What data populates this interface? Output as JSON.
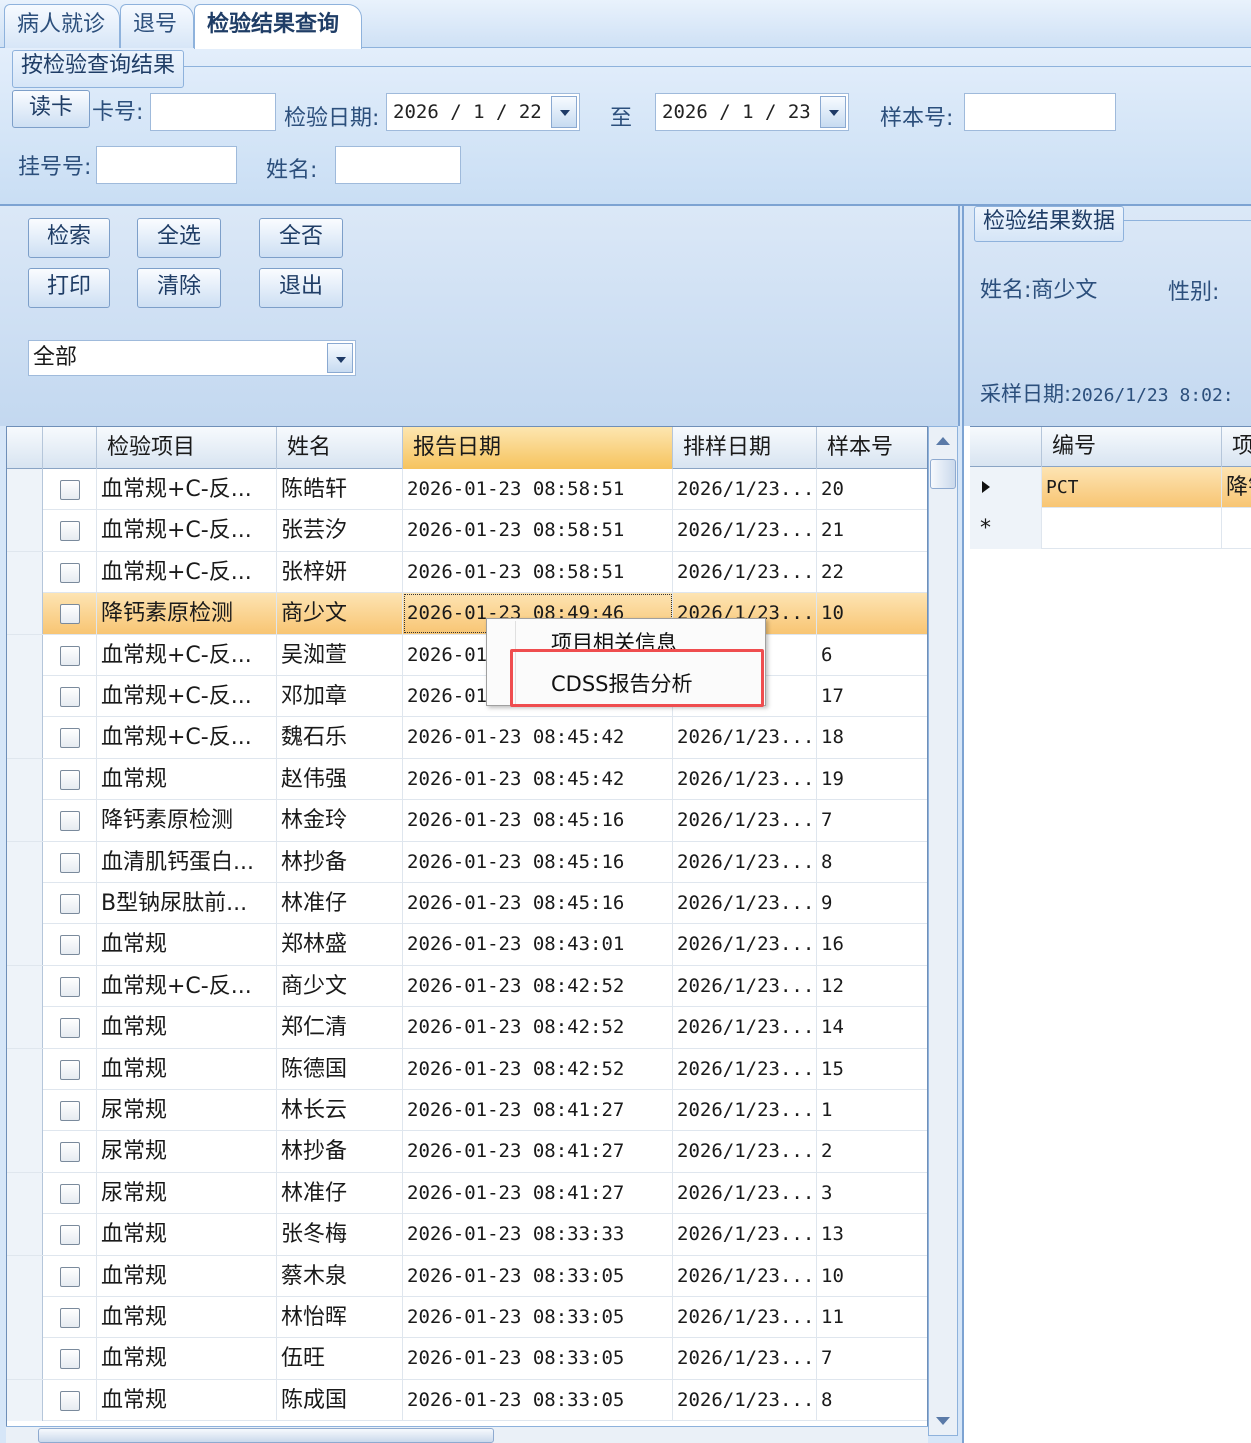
{
  "tabs": [
    "病人就诊",
    "退号",
    "检验结果查询"
  ],
  "query": {
    "group_title": "按检验查询结果",
    "read_card_button": "读卡",
    "card_no_label": "卡号:",
    "card_no_value": "",
    "exam_date_label": "检验日期:",
    "date_from": "2026 / 1 / 22",
    "to_label": "至",
    "date_to": "2026 / 1 / 23",
    "sample_no_label": "样本号:",
    "sample_no_value": "",
    "reg_no_label": "挂号号:",
    "reg_no_value": "",
    "name_label": "姓名:",
    "name_value": ""
  },
  "actions": {
    "search": "检索",
    "select_all": "全选",
    "select_none": "全否",
    "print": "打印",
    "clear": "清除",
    "exit": "退出"
  },
  "filter_combo": {
    "selected": "全部"
  },
  "grid": {
    "columns": [
      "检验项目",
      "姓名",
      "报告日期",
      "排样日期",
      "样本号"
    ],
    "sorted_column": "报告日期",
    "rows": [
      {
        "item": "血常规+C-反...",
        "name": "陈皓轩",
        "report_date": "2026-01-23 08:58:51",
        "sample_date": "2026/1/23...",
        "sample_no": "20",
        "checked": false
      },
      {
        "item": "血常规+C-反...",
        "name": "张芸汐",
        "report_date": "2026-01-23 08:58:51",
        "sample_date": "2026/1/23...",
        "sample_no": "21",
        "checked": false
      },
      {
        "item": "血常规+C-反...",
        "name": "张梓妍",
        "report_date": "2026-01-23 08:58:51",
        "sample_date": "2026/1/23...",
        "sample_no": "22",
        "checked": false
      },
      {
        "item": "降钙素原检测",
        "name": "商少文",
        "report_date": "2026-01-23 08:49:46",
        "sample_date": "2026/1/23...",
        "sample_no": "10",
        "checked": false,
        "selected": true
      },
      {
        "item": "血常规+C-反...",
        "name": "吴洳萱",
        "report_date": "2026-01",
        "sample_date": "3...",
        "sample_no": "6",
        "checked": false
      },
      {
        "item": "血常规+C-反...",
        "name": "邓加章",
        "report_date": "2026-01",
        "sample_date": "3...",
        "sample_no": "17",
        "checked": false
      },
      {
        "item": "血常规+C-反...",
        "name": "魏石乐",
        "report_date": "2026-01-23 08:45:42",
        "sample_date": "2026/1/23...",
        "sample_no": "18",
        "checked": false
      },
      {
        "item": "血常规",
        "name": "赵伟强",
        "report_date": "2026-01-23 08:45:42",
        "sample_date": "2026/1/23...",
        "sample_no": "19",
        "checked": false
      },
      {
        "item": "降钙素原检测",
        "name": "林金玲",
        "report_date": "2026-01-23 08:45:16",
        "sample_date": "2026/1/23...",
        "sample_no": "7",
        "checked": false
      },
      {
        "item": "血清肌钙蛋白...",
        "name": "林抄备",
        "report_date": "2026-01-23 08:45:16",
        "sample_date": "2026/1/23...",
        "sample_no": "8",
        "checked": false
      },
      {
        "item": "B型钠尿肽前...",
        "name": "林准仔",
        "report_date": "2026-01-23 08:45:16",
        "sample_date": "2026/1/23...",
        "sample_no": "9",
        "checked": false
      },
      {
        "item": "血常规",
        "name": "郑林盛",
        "report_date": "2026-01-23 08:43:01",
        "sample_date": "2026/1/23...",
        "sample_no": "16",
        "checked": false
      },
      {
        "item": "血常规+C-反...",
        "name": "商少文",
        "report_date": "2026-01-23 08:42:52",
        "sample_date": "2026/1/23...",
        "sample_no": "12",
        "checked": false
      },
      {
        "item": "血常规",
        "name": "郑仁清",
        "report_date": "2026-01-23 08:42:52",
        "sample_date": "2026/1/23...",
        "sample_no": "14",
        "checked": false
      },
      {
        "item": "血常规",
        "name": "陈德国",
        "report_date": "2026-01-23 08:42:52",
        "sample_date": "2026/1/23...",
        "sample_no": "15",
        "checked": false
      },
      {
        "item": "尿常规",
        "name": "林长云",
        "report_date": "2026-01-23 08:41:27",
        "sample_date": "2026/1/23...",
        "sample_no": "1",
        "checked": false
      },
      {
        "item": "尿常规",
        "name": "林抄备",
        "report_date": "2026-01-23 08:41:27",
        "sample_date": "2026/1/23...",
        "sample_no": "2",
        "checked": false
      },
      {
        "item": "尿常规",
        "name": "林准仔",
        "report_date": "2026-01-23 08:41:27",
        "sample_date": "2026/1/23...",
        "sample_no": "3",
        "checked": false
      },
      {
        "item": "血常规",
        "name": "张冬梅",
        "report_date": "2026-01-23 08:33:33",
        "sample_date": "2026/1/23...",
        "sample_no": "13",
        "checked": false
      },
      {
        "item": "血常规",
        "name": "蔡木泉",
        "report_date": "2026-01-23 08:33:05",
        "sample_date": "2026/1/23...",
        "sample_no": "10",
        "checked": false
      },
      {
        "item": "血常规",
        "name": "林怡晖",
        "report_date": "2026-01-23 08:33:05",
        "sample_date": "2026/1/23...",
        "sample_no": "11",
        "checked": false
      },
      {
        "item": "血常规",
        "name": "伍旺",
        "report_date": "2026-01-23 08:33:05",
        "sample_date": "2026/1/23...",
        "sample_no": "7",
        "checked": false
      },
      {
        "item": "血常规",
        "name": "陈成国",
        "report_date": "2026-01-23 08:33:05",
        "sample_date": "2026/1/23...",
        "sample_no": "8",
        "checked": false
      }
    ]
  },
  "context_menu": {
    "items": [
      "项目相关信息",
      "CDSS报告分析"
    ],
    "highlighted": "CDSS报告分析"
  },
  "result_panel": {
    "group_title": "检验结果数据",
    "name_label": "姓名:",
    "name_value": "商少文",
    "sex_label": "性别:",
    "sex_value": "",
    "sample_date_label": "采样日期:",
    "sample_date_value": "2026/1/23 8:02:",
    "columns": [
      "编号",
      "项"
    ],
    "rows": [
      {
        "code": "PCT",
        "item": "降钙"
      }
    ],
    "new_row_marker": "*"
  },
  "colors": {
    "selection": "#f8c573",
    "highlight_box": "#ef4d4f",
    "panel_blue": "#c9def4"
  }
}
